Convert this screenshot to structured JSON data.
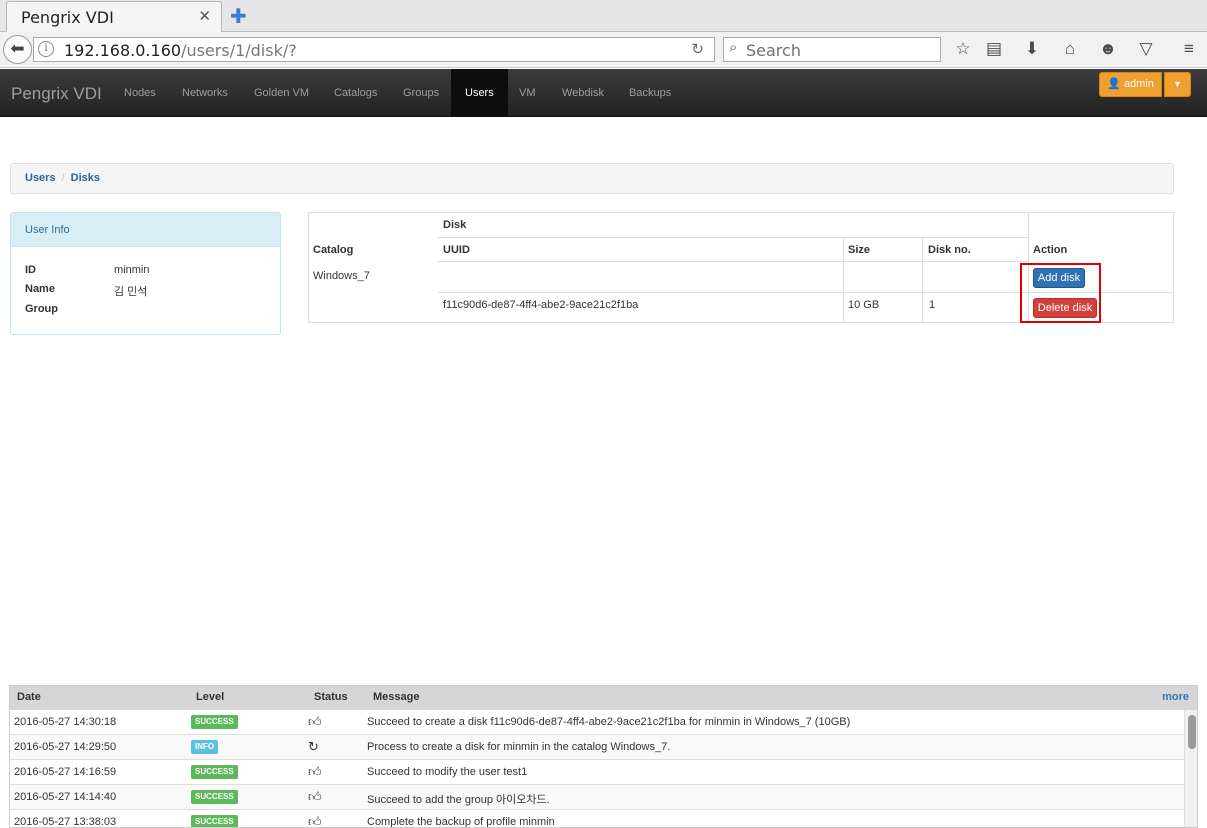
{
  "browser": {
    "tab_title": "Pengrix VDI",
    "url_host": "192.168.0.160",
    "url_path": "/users/1/disk/?",
    "search_placeholder": "Search"
  },
  "app": {
    "brand": "Pengrix VDI",
    "nav": [
      "Nodes",
      "Networks",
      "Golden VM",
      "Catalogs",
      "Groups",
      "Users",
      "VM",
      "Webdisk",
      "Backups"
    ],
    "active_nav": "Users",
    "user_button": "admin"
  },
  "breadcrumb": [
    "Users",
    "Disks"
  ],
  "user_info": {
    "title": "User Info",
    "rows": [
      {
        "label": "ID",
        "value": "minmin"
      },
      {
        "label": "Name",
        "value": "김 민석"
      },
      {
        "label": "Group",
        "value": ""
      }
    ]
  },
  "disk_table": {
    "group_header": "Disk",
    "headers": {
      "catalog": "Catalog",
      "uuid": "UUID",
      "size": "Size",
      "disk_no": "Disk no.",
      "action": "Action"
    },
    "catalog": "Windows_7",
    "add_button": "Add disk",
    "rows": [
      {
        "uuid": "f11c90d6-de87-4ff4-abe2-9ace21c2f1ba",
        "size": "10 GB",
        "disk_no": "1",
        "action": "Delete disk"
      }
    ]
  },
  "log": {
    "headers": {
      "date": "Date",
      "level": "Level",
      "status": "Status",
      "message": "Message"
    },
    "more": "more",
    "rows": [
      {
        "date": "2016-05-27 14:30:18",
        "level": "SUCCESS",
        "status_icon": "thumbs-up-icon",
        "message": "Succeed to create a disk f11c90d6-de87-4ff4-abe2-9ace21c2f1ba for minmin in Windows_7 (10GB)"
      },
      {
        "date": "2016-05-27 14:29:50",
        "level": "INFO",
        "status_icon": "refresh-icon",
        "message": "Process to create a disk for minmin in the catalog Windows_7."
      },
      {
        "date": "2016-05-27 14:16:59",
        "level": "SUCCESS",
        "status_icon": "thumbs-up-icon",
        "message": "Succeed to modify the user test1"
      },
      {
        "date": "2016-05-27 14:14:40",
        "level": "SUCCESS",
        "status_icon": "thumbs-up-icon",
        "message": "Succeed to add the group 아이오차드."
      },
      {
        "date": "2016-05-27 13:38:03",
        "level": "SUCCESS",
        "status_icon": "thumbs-up-icon",
        "message": "Complete the backup of profile minmin"
      }
    ]
  },
  "colors": {
    "success": "#5cb85c",
    "info": "#5bc0de",
    "primary": "#2f73b5",
    "danger": "#d2403c",
    "admin": "#f0a030",
    "highlight": "#e00000"
  }
}
